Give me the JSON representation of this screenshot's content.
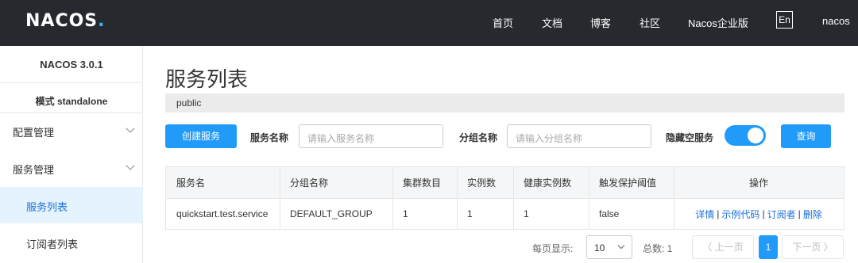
{
  "topbar": {
    "logo": "NACOS",
    "logo_dot": ".",
    "nav": [
      "首页",
      "文档",
      "博客",
      "社区",
      "Nacos企业版"
    ],
    "lang": "En",
    "user": "nacos"
  },
  "sidebar": {
    "version": "NACOS 3.0.1",
    "mode": "模式 standalone",
    "items": [
      {
        "label": "配置管理"
      },
      {
        "label": "服务管理"
      },
      {
        "label": "服务列表"
      },
      {
        "label": "订阅者列表"
      }
    ]
  },
  "main": {
    "title": "服务列表",
    "namespace": "public",
    "create_button": "创建服务",
    "service_name_label": "服务名称",
    "service_name_placeholder": "请输入服务名称",
    "group_name_label": "分组名称",
    "group_name_placeholder": "请输入分组名称",
    "hide_empty_label": "隐藏空服务",
    "hide_empty_on": true,
    "query_button": "查询"
  },
  "table": {
    "headers": [
      "服务名",
      "分组名称",
      "集群数目",
      "实例数",
      "健康实例数",
      "触发保护阈值",
      "操作"
    ],
    "rows": [
      {
        "service": "quickstart.test.service",
        "group": "DEFAULT_GROUP",
        "clusters": "1",
        "instances": "1",
        "healthy": "1",
        "threshold": "false",
        "ops": [
          "详情",
          "示例代码",
          "订阅者",
          "删除"
        ]
      }
    ]
  },
  "pagination": {
    "per_page_label": "每页显示:",
    "per_page_value": "10",
    "total_label": "总数: 1",
    "prev": "〈 上一页",
    "current": "1",
    "next": "下一页 〉"
  },
  "colors": {
    "accent": "#209bfa",
    "topbar": "#262a2f",
    "link": "#1a70d9"
  }
}
